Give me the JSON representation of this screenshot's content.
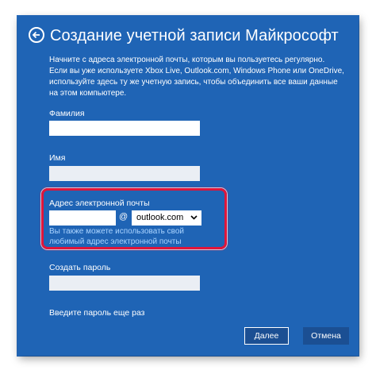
{
  "header": {
    "title": "Создание учетной записи Майкрософт",
    "back_icon": "arrow-left-circle-icon"
  },
  "intro": {
    "text": "Начните с адреса электронной почты, которым вы пользуетесь регулярно. Если вы уже используете Xbox Live, Outlook.com, Windows Phone или OneDrive, используйте здесь ту же учетную запись, чтобы объединить все ваши данные на этом компьютере."
  },
  "form": {
    "last_name_label": "Фамилия",
    "last_name_value": "",
    "first_name_label": "Имя",
    "first_name_value": "",
    "email_label": "Адрес электронной почты",
    "email_value": "",
    "at_sign": "@",
    "domain_selected": "outlook.com",
    "own_email_link": "Вы также можете использовать свой любимый адрес электронной почты",
    "password_label": "Создать пароль",
    "password_value": "",
    "password_repeat_label": "Введите пароль еще раз"
  },
  "buttons": {
    "next": "Далее",
    "cancel": "Отмена"
  },
  "colors": {
    "background": "#1f64b5",
    "highlight_border": "#e0153a",
    "link": "#a9d3ff"
  }
}
